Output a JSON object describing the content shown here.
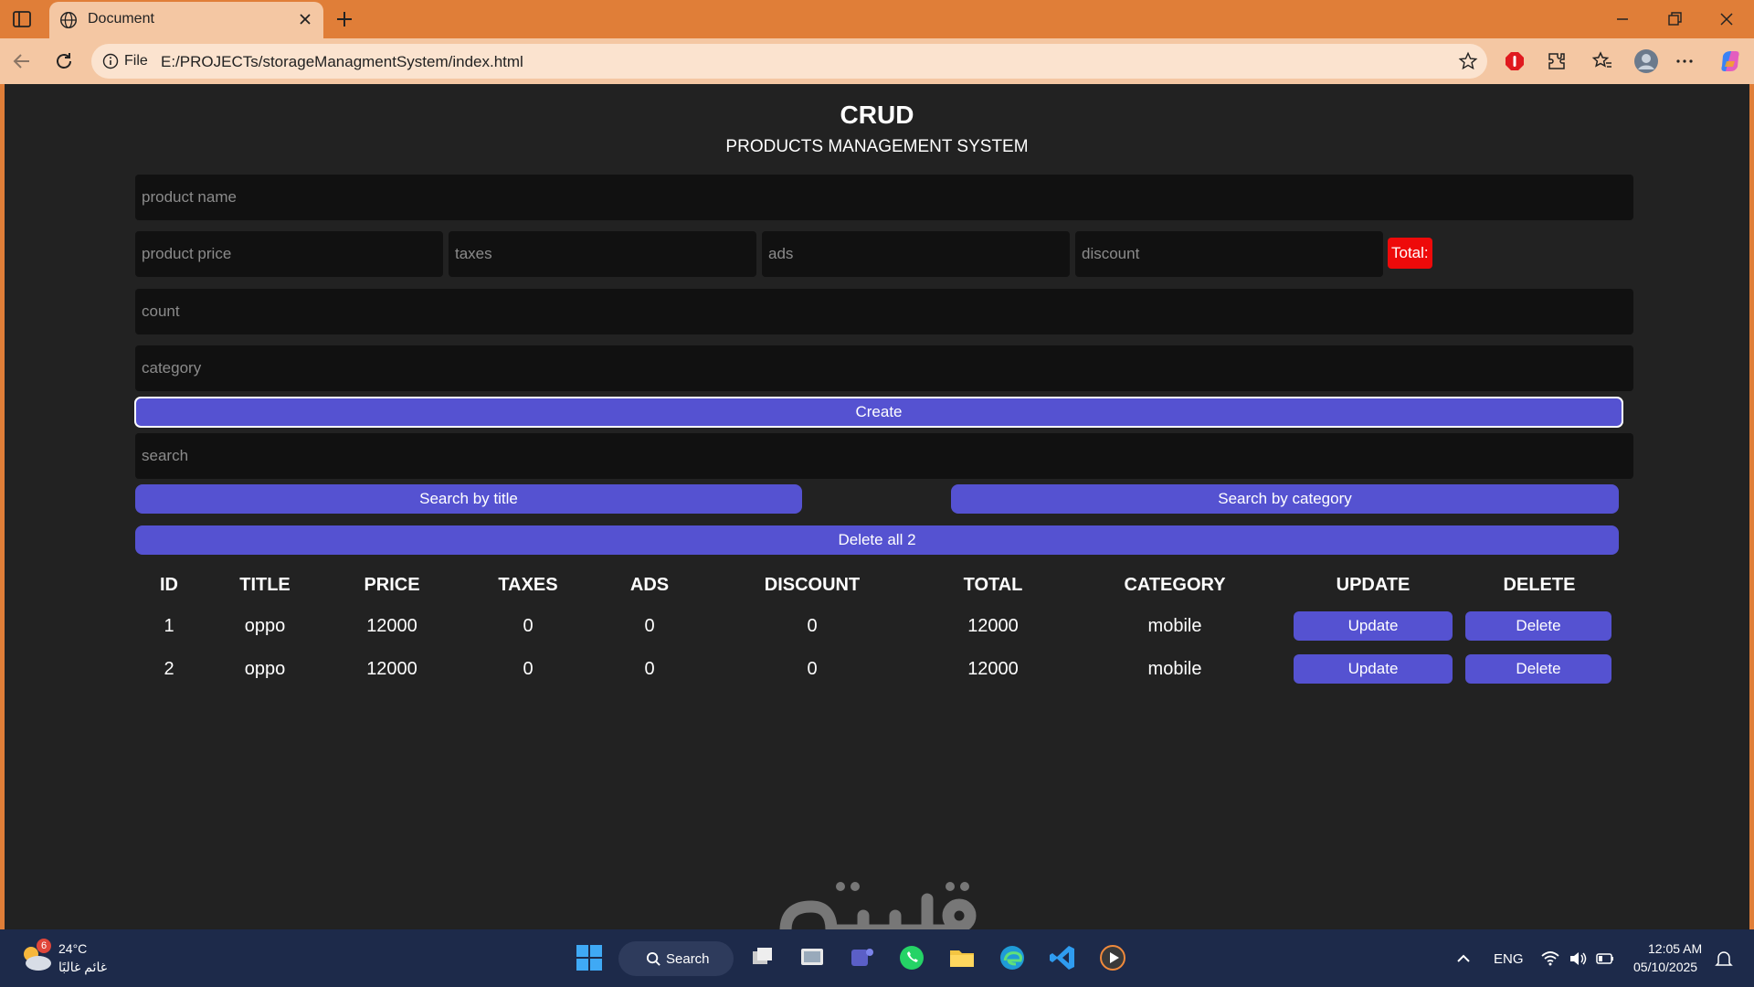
{
  "browser": {
    "tab_title": "Document",
    "url_scheme_label": "File",
    "url": "E:/PROJECTs/storageManagmentSystem/index.html"
  },
  "app": {
    "title": "CRUD",
    "subtitle": "PRODUCTS MANAGEMENT SYSTEM",
    "placeholders": {
      "product_name": "product name",
      "price": "product price",
      "taxes": "taxes",
      "ads": "ads",
      "discount": "discount",
      "count": "count",
      "category": "category",
      "search": "search"
    },
    "total_label": "Total:",
    "create_label": "Create",
    "search_by_title_label": "Search by title",
    "search_by_category_label": "Search by category",
    "delete_all_label": "Delete all 2"
  },
  "table": {
    "headers": [
      "ID",
      "TITLE",
      "PRICE",
      "TAXES",
      "ADS",
      "DISCOUNT",
      "TOTAL",
      "CATEGORY",
      "UPDATE",
      "DELETE"
    ],
    "rows": [
      {
        "id": "1",
        "title": "oppo",
        "price": "12000",
        "taxes": "0",
        "ads": "0",
        "discount": "0",
        "total": "12000",
        "category": "mobile",
        "update_label": "Update",
        "delete_label": "Delete"
      },
      {
        "id": "2",
        "title": "oppo",
        "price": "12000",
        "taxes": "0",
        "ads": "0",
        "discount": "0",
        "total": "12000",
        "category": "mobile",
        "update_label": "Update",
        "delete_label": "Delete"
      }
    ]
  },
  "taskbar": {
    "weather_badge": "6",
    "weather_temp": "24°C",
    "weather_desc": "غائم غالبًا",
    "search_label": "Search",
    "language": "ENG",
    "time": "12:05 AM",
    "date": "05/10/2025"
  },
  "colors": {
    "accent_button": "#5552d1",
    "total_badge": "#ee0a0a",
    "page_background": "#222222",
    "browser_frame": "#e07e38"
  }
}
